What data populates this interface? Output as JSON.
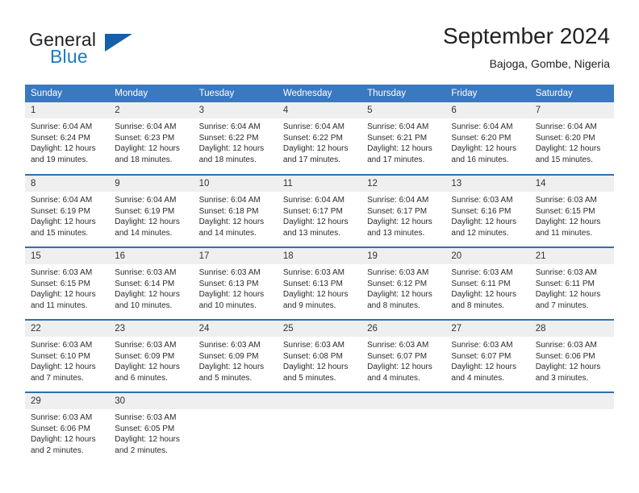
{
  "logo": {
    "word_one": "General",
    "word_two": "Blue",
    "triangle_icon": "triangle-icon"
  },
  "header": {
    "title": "September 2024",
    "location": "Bajoga, Gombe, Nigeria"
  },
  "colors": {
    "header_blue": "#3a78bf",
    "row_divider_blue": "#2f6fb5",
    "daynum_band": "#efefef",
    "logo_blue": "#1f7bc1",
    "logo_triangle": "#1361a8"
  },
  "weekday_headers": [
    "Sunday",
    "Monday",
    "Tuesday",
    "Wednesday",
    "Thursday",
    "Friday",
    "Saturday"
  ],
  "weeks": [
    [
      {
        "day": "1",
        "sunrise": "Sunrise: 6:04 AM",
        "sunset": "Sunset: 6:24 PM",
        "daylight": "Daylight: 12 hours and 19 minutes."
      },
      {
        "day": "2",
        "sunrise": "Sunrise: 6:04 AM",
        "sunset": "Sunset: 6:23 PM",
        "daylight": "Daylight: 12 hours and 18 minutes."
      },
      {
        "day": "3",
        "sunrise": "Sunrise: 6:04 AM",
        "sunset": "Sunset: 6:22 PM",
        "daylight": "Daylight: 12 hours and 18 minutes."
      },
      {
        "day": "4",
        "sunrise": "Sunrise: 6:04 AM",
        "sunset": "Sunset: 6:22 PM",
        "daylight": "Daylight: 12 hours and 17 minutes."
      },
      {
        "day": "5",
        "sunrise": "Sunrise: 6:04 AM",
        "sunset": "Sunset: 6:21 PM",
        "daylight": "Daylight: 12 hours and 17 minutes."
      },
      {
        "day": "6",
        "sunrise": "Sunrise: 6:04 AM",
        "sunset": "Sunset: 6:20 PM",
        "daylight": "Daylight: 12 hours and 16 minutes."
      },
      {
        "day": "7",
        "sunrise": "Sunrise: 6:04 AM",
        "sunset": "Sunset: 6:20 PM",
        "daylight": "Daylight: 12 hours and 15 minutes."
      }
    ],
    [
      {
        "day": "8",
        "sunrise": "Sunrise: 6:04 AM",
        "sunset": "Sunset: 6:19 PM",
        "daylight": "Daylight: 12 hours and 15 minutes."
      },
      {
        "day": "9",
        "sunrise": "Sunrise: 6:04 AM",
        "sunset": "Sunset: 6:19 PM",
        "daylight": "Daylight: 12 hours and 14 minutes."
      },
      {
        "day": "10",
        "sunrise": "Sunrise: 6:04 AM",
        "sunset": "Sunset: 6:18 PM",
        "daylight": "Daylight: 12 hours and 14 minutes."
      },
      {
        "day": "11",
        "sunrise": "Sunrise: 6:04 AM",
        "sunset": "Sunset: 6:17 PM",
        "daylight": "Daylight: 12 hours and 13 minutes."
      },
      {
        "day": "12",
        "sunrise": "Sunrise: 6:04 AM",
        "sunset": "Sunset: 6:17 PM",
        "daylight": "Daylight: 12 hours and 13 minutes."
      },
      {
        "day": "13",
        "sunrise": "Sunrise: 6:03 AM",
        "sunset": "Sunset: 6:16 PM",
        "daylight": "Daylight: 12 hours and 12 minutes."
      },
      {
        "day": "14",
        "sunrise": "Sunrise: 6:03 AM",
        "sunset": "Sunset: 6:15 PM",
        "daylight": "Daylight: 12 hours and 11 minutes."
      }
    ],
    [
      {
        "day": "15",
        "sunrise": "Sunrise: 6:03 AM",
        "sunset": "Sunset: 6:15 PM",
        "daylight": "Daylight: 12 hours and 11 minutes."
      },
      {
        "day": "16",
        "sunrise": "Sunrise: 6:03 AM",
        "sunset": "Sunset: 6:14 PM",
        "daylight": "Daylight: 12 hours and 10 minutes."
      },
      {
        "day": "17",
        "sunrise": "Sunrise: 6:03 AM",
        "sunset": "Sunset: 6:13 PM",
        "daylight": "Daylight: 12 hours and 10 minutes."
      },
      {
        "day": "18",
        "sunrise": "Sunrise: 6:03 AM",
        "sunset": "Sunset: 6:13 PM",
        "daylight": "Daylight: 12 hours and 9 minutes."
      },
      {
        "day": "19",
        "sunrise": "Sunrise: 6:03 AM",
        "sunset": "Sunset: 6:12 PM",
        "daylight": "Daylight: 12 hours and 8 minutes."
      },
      {
        "day": "20",
        "sunrise": "Sunrise: 6:03 AM",
        "sunset": "Sunset: 6:11 PM",
        "daylight": "Daylight: 12 hours and 8 minutes."
      },
      {
        "day": "21",
        "sunrise": "Sunrise: 6:03 AM",
        "sunset": "Sunset: 6:11 PM",
        "daylight": "Daylight: 12 hours and 7 minutes."
      }
    ],
    [
      {
        "day": "22",
        "sunrise": "Sunrise: 6:03 AM",
        "sunset": "Sunset: 6:10 PM",
        "daylight": "Daylight: 12 hours and 7 minutes."
      },
      {
        "day": "23",
        "sunrise": "Sunrise: 6:03 AM",
        "sunset": "Sunset: 6:09 PM",
        "daylight": "Daylight: 12 hours and 6 minutes."
      },
      {
        "day": "24",
        "sunrise": "Sunrise: 6:03 AM",
        "sunset": "Sunset: 6:09 PM",
        "daylight": "Daylight: 12 hours and 5 minutes."
      },
      {
        "day": "25",
        "sunrise": "Sunrise: 6:03 AM",
        "sunset": "Sunset: 6:08 PM",
        "daylight": "Daylight: 12 hours and 5 minutes."
      },
      {
        "day": "26",
        "sunrise": "Sunrise: 6:03 AM",
        "sunset": "Sunset: 6:07 PM",
        "daylight": "Daylight: 12 hours and 4 minutes."
      },
      {
        "day": "27",
        "sunrise": "Sunrise: 6:03 AM",
        "sunset": "Sunset: 6:07 PM",
        "daylight": "Daylight: 12 hours and 4 minutes."
      },
      {
        "day": "28",
        "sunrise": "Sunrise: 6:03 AM",
        "sunset": "Sunset: 6:06 PM",
        "daylight": "Daylight: 12 hours and 3 minutes."
      }
    ],
    [
      {
        "day": "29",
        "sunrise": "Sunrise: 6:03 AM",
        "sunset": "Sunset: 6:06 PM",
        "daylight": "Daylight: 12 hours and 2 minutes."
      },
      {
        "day": "30",
        "sunrise": "Sunrise: 6:03 AM",
        "sunset": "Sunset: 6:05 PM",
        "daylight": "Daylight: 12 hours and 2 minutes."
      },
      {
        "day": "",
        "sunrise": "",
        "sunset": "",
        "daylight": ""
      },
      {
        "day": "",
        "sunrise": "",
        "sunset": "",
        "daylight": ""
      },
      {
        "day": "",
        "sunrise": "",
        "sunset": "",
        "daylight": ""
      },
      {
        "day": "",
        "sunrise": "",
        "sunset": "",
        "daylight": ""
      },
      {
        "day": "",
        "sunrise": "",
        "sunset": "",
        "daylight": ""
      }
    ]
  ]
}
